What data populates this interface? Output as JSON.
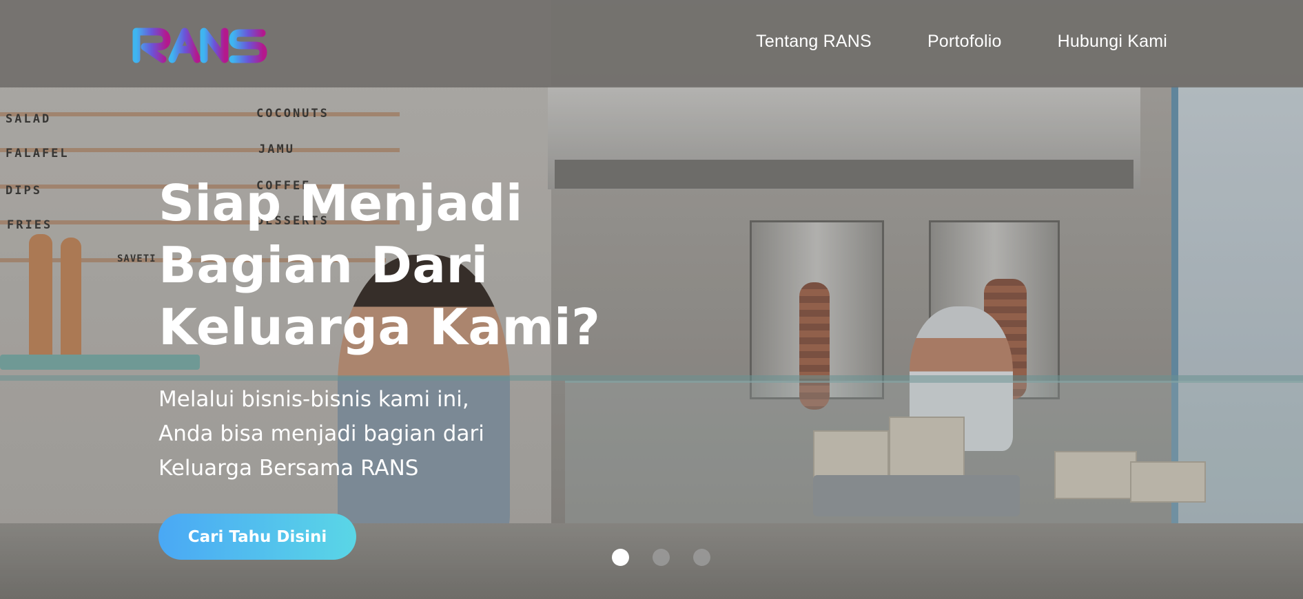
{
  "brand": {
    "logo_text": "RANS"
  },
  "nav": {
    "items": [
      {
        "label": "Tentang RANS"
      },
      {
        "label": "Portofolio"
      },
      {
        "label": "Hubungi Kami"
      }
    ]
  },
  "hero": {
    "headline_lines": [
      "Siap Menjadi",
      "Bagian Dari",
      "Keluarga Kami?"
    ],
    "subtext_lines": [
      "Melalui bisnis-bisnis kami ini,",
      "Anda bisa menjadi bagian dari",
      "Keluarga Bersama RANS"
    ],
    "cta_label": "Cari Tahu Disini",
    "background_menu_words": [
      "SALAD",
      "COCONUTS",
      "FALAFEL",
      "JAMU",
      "DIPS",
      "COFFEE",
      "FRIES",
      "DESSERTS",
      "SAVETI"
    ]
  },
  "carousel": {
    "slides": 3,
    "active_index": 0
  },
  "colors": {
    "cta_gradient_start": "#4aa8f5",
    "cta_gradient_end": "#5ad6e6",
    "logo_gradient_start": "#3fb5f0",
    "logo_gradient_end": "#b4188c"
  }
}
